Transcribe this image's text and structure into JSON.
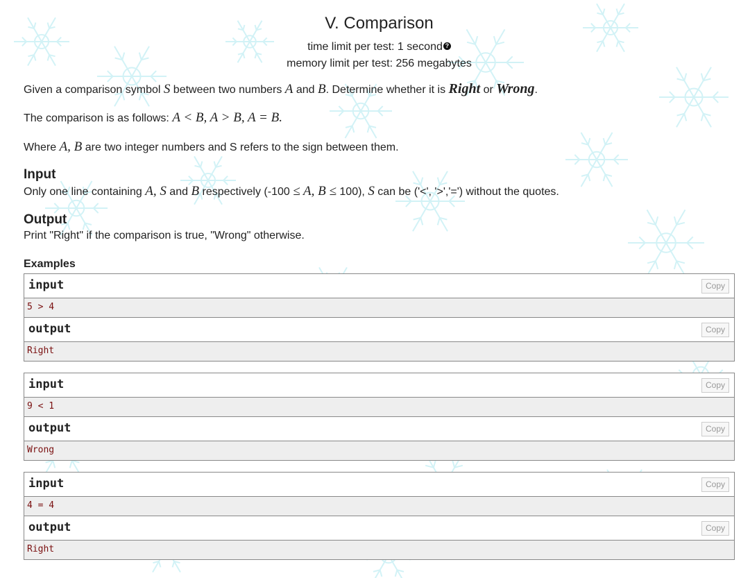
{
  "problem": {
    "title": "V. Comparison",
    "time_limit": "time limit per test: 1 second",
    "memory_limit": "memory limit per test: 256 megabytes",
    "statement": {
      "p1_a": "Given a comparison symbol ",
      "p1_s": "S",
      "p1_b": " between two numbers ",
      "p1_A": "A",
      "p1_c": " and ",
      "p1_B": "B",
      "p1_d": ". Determine whether it is ",
      "p1_right": "Right",
      "p1_e": " or ",
      "p1_wrong": "Wrong",
      "p1_f": ".",
      "p2_a": "The comparison is as follows: ",
      "p2_math": "A < B, A > B, A = B.",
      "p3_a": "Where ",
      "p3_AB": "A, B",
      "p3_b": " are two integer numbers and S refers to the sign between them."
    },
    "input_section": {
      "heading": "Input",
      "t1": "Only one line containing ",
      "m1": "A, S",
      "t2": " and ",
      "m2": "B",
      "t3": " respectively (-100 ",
      "m3": "≤ A, B ≤",
      "t4": " 100), ",
      "m4": "S",
      "t5": " can be ('<', '>','=') without the quotes."
    },
    "output_section": {
      "heading": "Output",
      "text": "Print \"Right\" if the comparison is true, \"Wrong\" otherwise."
    },
    "examples_heading": "Examples",
    "input_label": "input",
    "output_label": "output",
    "copy_label": "Copy",
    "examples": [
      {
        "input": "5 > 4",
        "output": "Right"
      },
      {
        "input": "9 < 1",
        "output": "Wrong"
      },
      {
        "input": "4 = 4",
        "output": "Right"
      }
    ]
  }
}
